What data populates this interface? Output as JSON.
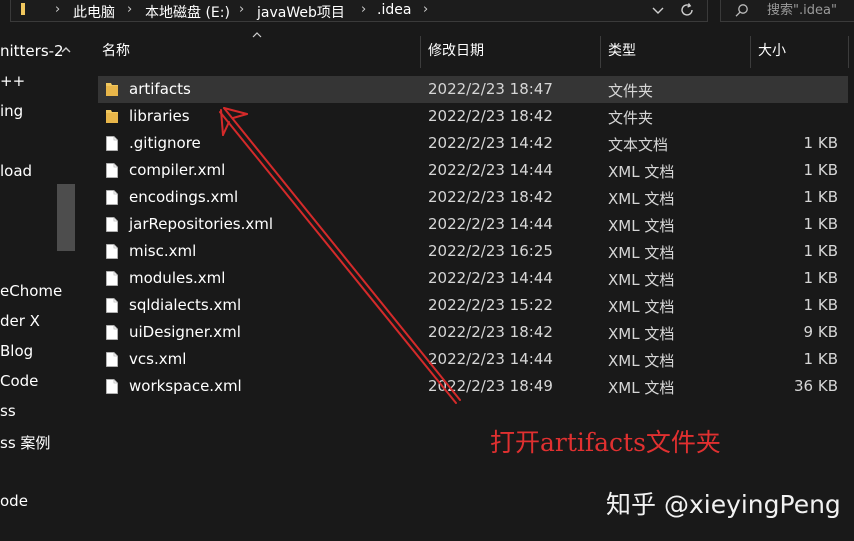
{
  "address_bar": {
    "crumbs": [
      "此电脑",
      "本地磁盘 (E:)",
      "javaWeb项目",
      ".idea"
    ]
  },
  "search": {
    "placeholder": "搜索\".idea\""
  },
  "sidebar": {
    "items": [
      "nitters-2",
      "++",
      "ing",
      "",
      "load",
      "",
      "",
      "",
      "",
      "eChome",
      "der X",
      "Blog",
      "Code",
      "ss",
      "ss 案例",
      "",
      "ode"
    ]
  },
  "columns": {
    "name": "名称",
    "date": "修改日期",
    "type": "类型",
    "size": "大小"
  },
  "files": [
    {
      "name": "artifacts",
      "date": "2022/2/23 18:47",
      "type": "文件夹",
      "size": "",
      "icon": "folder-icon"
    },
    {
      "name": "libraries",
      "date": "2022/2/23 18:42",
      "type": "文件夹",
      "size": "",
      "icon": "folder-icon"
    },
    {
      "name": ".gitignore",
      "date": "2022/2/23 14:42",
      "type": "文本文档",
      "size": "1 KB",
      "icon": "file-icon"
    },
    {
      "name": "compiler.xml",
      "date": "2022/2/23 14:44",
      "type": "XML 文档",
      "size": "1 KB",
      "icon": "file-icon"
    },
    {
      "name": "encodings.xml",
      "date": "2022/2/23 18:42",
      "type": "XML 文档",
      "size": "1 KB",
      "icon": "file-icon"
    },
    {
      "name": "jarRepositories.xml",
      "date": "2022/2/23 14:44",
      "type": "XML 文档",
      "size": "1 KB",
      "icon": "file-icon"
    },
    {
      "name": "misc.xml",
      "date": "2022/2/23 16:25",
      "type": "XML 文档",
      "size": "1 KB",
      "icon": "file-icon"
    },
    {
      "name": "modules.xml",
      "date": "2022/2/23 14:44",
      "type": "XML 文档",
      "size": "1 KB",
      "icon": "file-icon"
    },
    {
      "name": "sqldialects.xml",
      "date": "2022/2/23 15:22",
      "type": "XML 文档",
      "size": "1 KB",
      "icon": "file-icon"
    },
    {
      "name": "uiDesigner.xml",
      "date": "2022/2/23 18:42",
      "type": "XML 文档",
      "size": "9 KB",
      "icon": "file-icon"
    },
    {
      "name": "vcs.xml",
      "date": "2022/2/23 14:44",
      "type": "XML 文档",
      "size": "1 KB",
      "icon": "file-icon"
    },
    {
      "name": "workspace.xml",
      "date": "2022/2/23 18:49",
      "type": "XML 文档",
      "size": "36 KB",
      "icon": "file-icon"
    }
  ],
  "annotation": {
    "text": "打开artifacts文件夹",
    "color": "#e03030"
  },
  "watermark": {
    "text": "知乎 @xieyingPeng"
  },
  "colors": {
    "background": "#191919",
    "selected_row": "#353535",
    "folder": "#f0c75e"
  }
}
